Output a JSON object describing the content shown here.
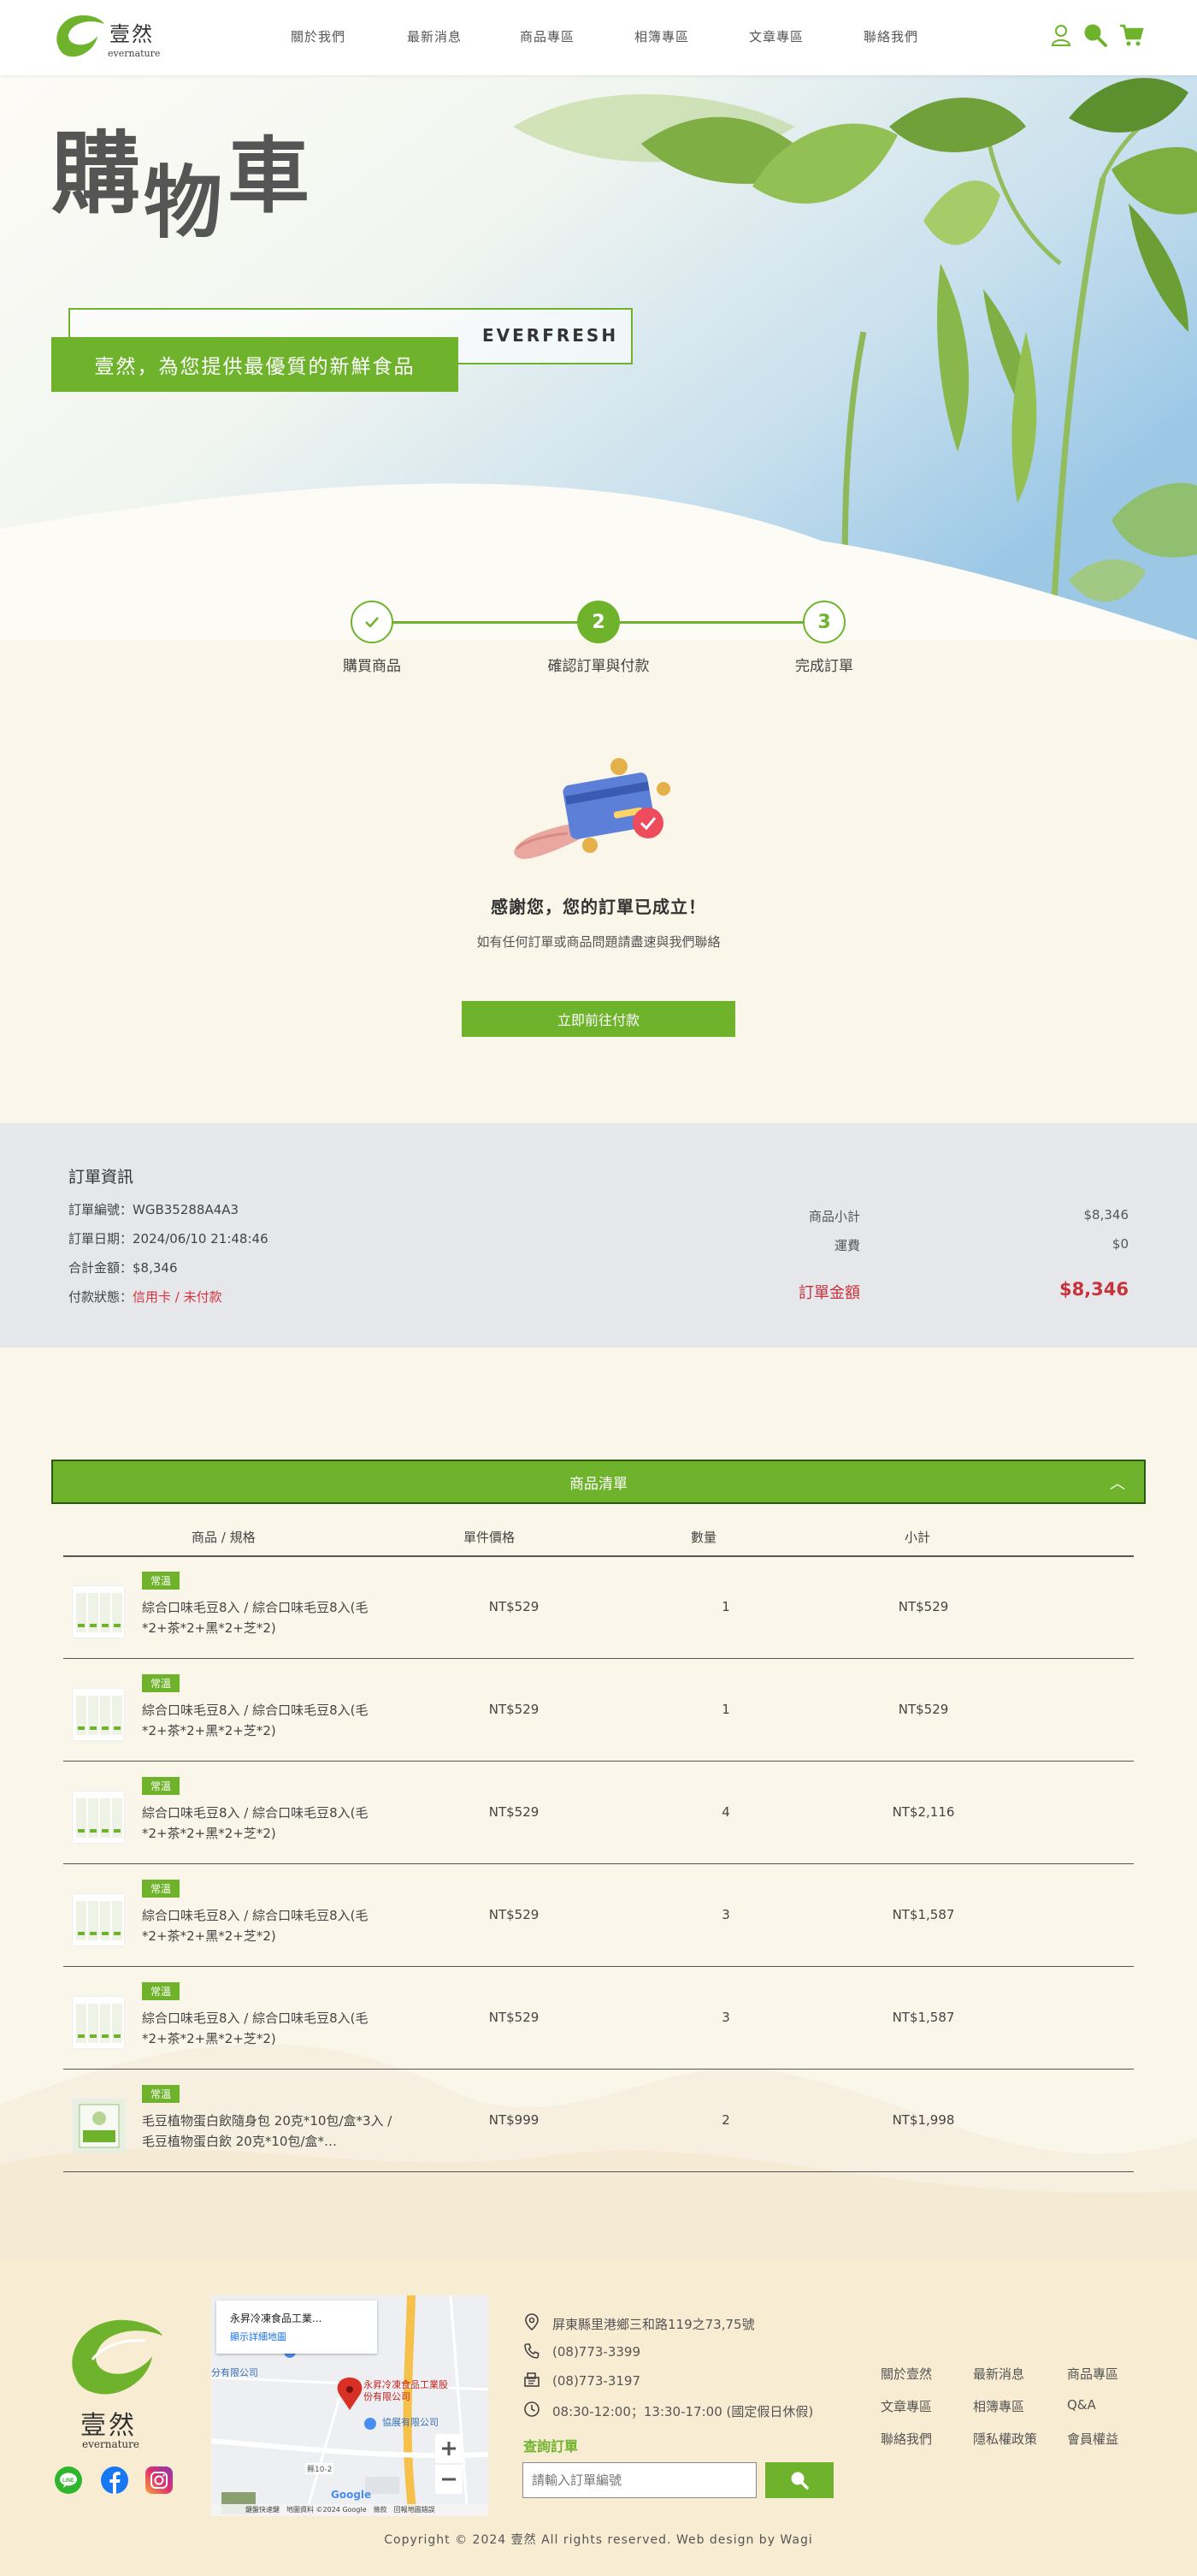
{
  "header": {
    "logo_cn": "壹然",
    "logo_en": "evernature",
    "nav": [
      "關於我們",
      "最新消息",
      "商品專區",
      "相簿專區",
      "文章專區",
      "聯絡我們"
    ],
    "icons": [
      "user-icon",
      "search-icon",
      "cart-icon"
    ]
  },
  "hero": {
    "title": [
      "購",
      "物",
      "車"
    ],
    "slogan": "壹然，為您提供最優質的新鮮食品",
    "everfresh": "EVERFRESH"
  },
  "steps": [
    {
      "label": "購買商品",
      "mark": "",
      "state": "done"
    },
    {
      "label": "確認訂單與付款",
      "mark": "2",
      "state": "current"
    },
    {
      "label": "完成訂單",
      "mark": "3",
      "state": "todo"
    }
  ],
  "thanks": {
    "title": "感謝您，您的訂單已成立！",
    "subtitle": "如有任何訂單或商品問題請盡速與我們聯絡",
    "pay_button": "立即前往付款"
  },
  "order": {
    "title": "訂單資訊",
    "fields": [
      {
        "label": "訂單編號：",
        "value": "WGB35288A4A3"
      },
      {
        "label": "訂單日期：",
        "value": "2024/06/10 21:48:46"
      },
      {
        "label": "合計金額：",
        "value": "$8,346"
      },
      {
        "label": "付款狀態：",
        "value": "信用卡 / 未付款"
      }
    ],
    "subtotal_label": "商品小計",
    "subtotal": "$8,346",
    "shipping_label": "運費",
    "shipping": "$0",
    "total_label": "訂單金額",
    "total": "$8,346"
  },
  "product_list": {
    "title": "商品清單",
    "headers": [
      "商品 / 規格",
      "單件價格",
      "數量",
      "小計"
    ],
    "items": [
      {
        "tag": "常溫",
        "name": "綜合口味毛豆8入 / 綜合口味毛豆8入(毛*2+茶*2+黑*2+芝*2)",
        "price": "NT$529",
        "qty": "1",
        "subtotal": "NT$529"
      },
      {
        "tag": "常溫",
        "name": "綜合口味毛豆8入 / 綜合口味毛豆8入(毛*2+茶*2+黑*2+芝*2)",
        "price": "NT$529",
        "qty": "1",
        "subtotal": "NT$529"
      },
      {
        "tag": "常溫",
        "name": "綜合口味毛豆8入 / 綜合口味毛豆8入(毛*2+茶*2+黑*2+芝*2)",
        "price": "NT$529",
        "qty": "4",
        "subtotal": "NT$2,116"
      },
      {
        "tag": "常溫",
        "name": "綜合口味毛豆8入 / 綜合口味毛豆8入(毛*2+茶*2+黑*2+芝*2)",
        "price": "NT$529",
        "qty": "3",
        "subtotal": "NT$1,587"
      },
      {
        "tag": "常溫",
        "name": "綜合口味毛豆8入 / 綜合口味毛豆8入(毛*2+茶*2+黑*2+芝*2)",
        "price": "NT$529",
        "qty": "3",
        "subtotal": "NT$1,587"
      },
      {
        "tag": "常溫",
        "name": "毛豆植物蛋白飲隨身包 20克*10包/盒*3入 / 毛豆植物蛋白飲 20克*10包/盒*…",
        "price": "NT$999",
        "qty": "2",
        "subtotal": "NT$1,998"
      }
    ]
  },
  "footer": {
    "logo_cn": "壹然",
    "logo_en": "evernature",
    "social": [
      "line-icon",
      "facebook-icon",
      "instagram-icon"
    ],
    "map": {
      "place": "永昇冷凍食品工業...",
      "link": "顯示詳細地圖",
      "pin_label": "永昇冷凍食品工業股份有限公司",
      "label_left": "分有限公司",
      "label_right": "協展有限公司",
      "road": "縣10-2",
      "attrib": "鍵盤快速鍵　地圖資料 ©2024 Google　條款　回報地圖錯誤",
      "google": "Google"
    },
    "address": "屏東縣里港鄉三和路119之73,75號",
    "phone": "(08)773-3399",
    "fax": "(08)773-3197",
    "hours": "08:30-12:00；13:30-17:00 (國定假日休假)",
    "query_title": "查詢訂單",
    "query_placeholder": "請輸入訂單編號",
    "links": [
      "關於壹然",
      "最新消息",
      "商品專區",
      "文章專區",
      "相簿專區",
      "Q&A",
      "聯絡我們",
      "隱私權政策",
      "會員權益"
    ],
    "copyright": "Copyright © 2024 壹然 All rights reserved. Web design by Wagi"
  },
  "colors": {
    "brand_green": "#6fb32d",
    "unpaid_red": "#d8333f",
    "total_red": "#c8323c"
  }
}
